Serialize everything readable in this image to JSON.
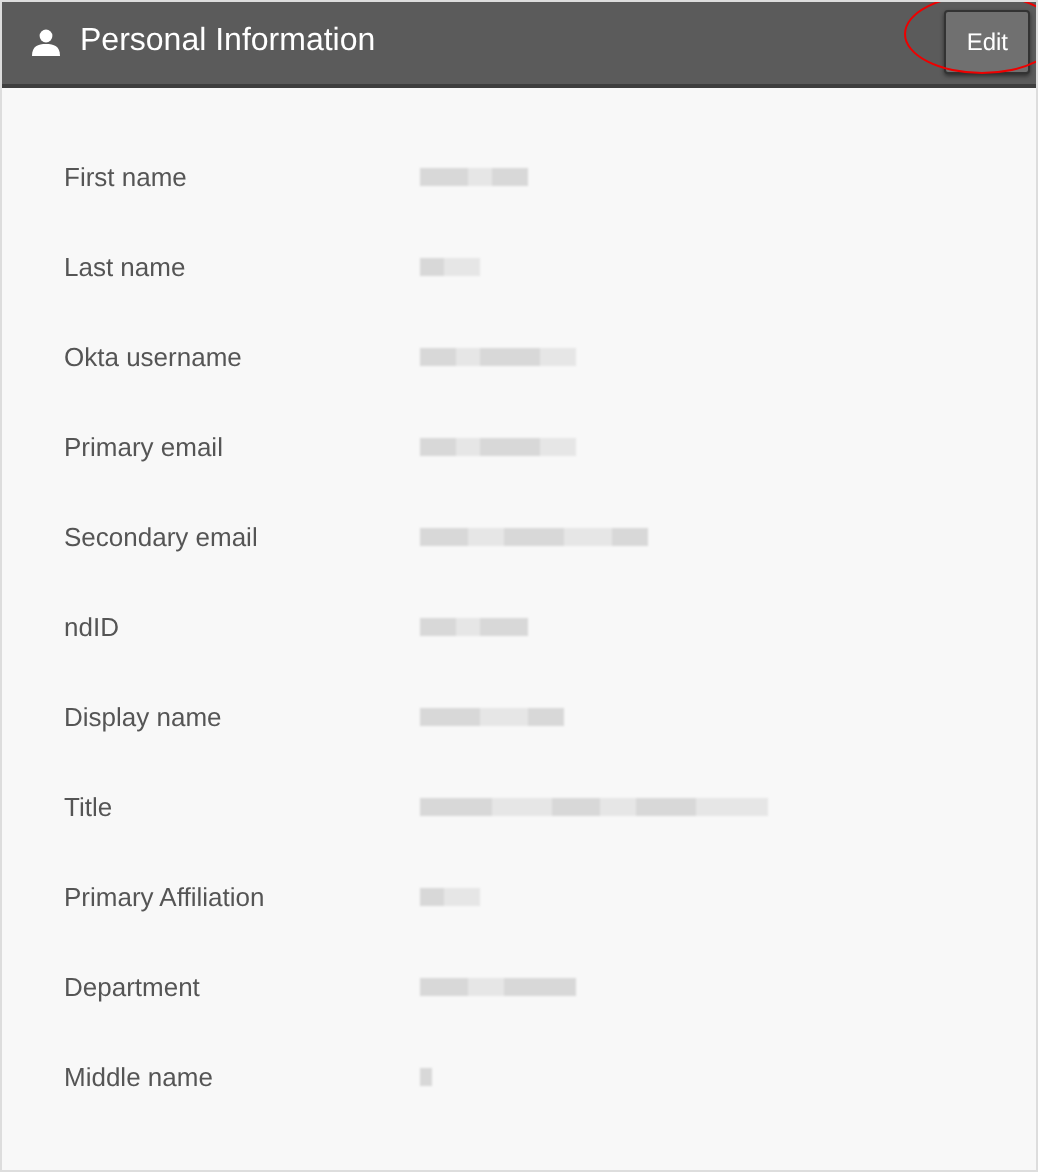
{
  "panel": {
    "title": "Personal Information",
    "edit_button": {
      "label": "Edit",
      "highlighted": true
    }
  },
  "fields": [
    {
      "label": "First name"
    },
    {
      "label": "Last name"
    },
    {
      "label": "Okta username"
    },
    {
      "label": "Primary email"
    },
    {
      "label": "Secondary email"
    },
    {
      "label": "ndID"
    },
    {
      "label": "Display name"
    },
    {
      "label": "Title"
    },
    {
      "label": "Primary Affiliation"
    },
    {
      "label": "Department"
    },
    {
      "label": "Middle name"
    }
  ]
}
